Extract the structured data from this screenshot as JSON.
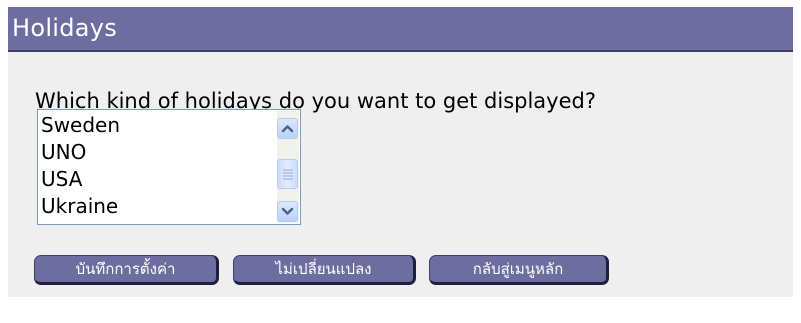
{
  "header": {
    "title": "Holidays"
  },
  "form": {
    "question": "Which kind of holidays do you want to get displayed?",
    "list_items": [
      "Sweden",
      "UNO",
      "USA",
      "Ukraine"
    ]
  },
  "buttons": {
    "save_label": "บันทึกการตั้งค่า",
    "cancel_label": "ไม่เปลี่ยนแปลง",
    "main_menu_label": "กลับสู่เมนูหลัก"
  },
  "colors": {
    "header_background": "#6d6d9f",
    "button_background": "#6d6d9f",
    "body_background": "#efefef"
  },
  "icons": [
    "scroll-up-arrow-icon",
    "scroll-thumb-grip-icon",
    "scroll-down-arrow-icon"
  ]
}
